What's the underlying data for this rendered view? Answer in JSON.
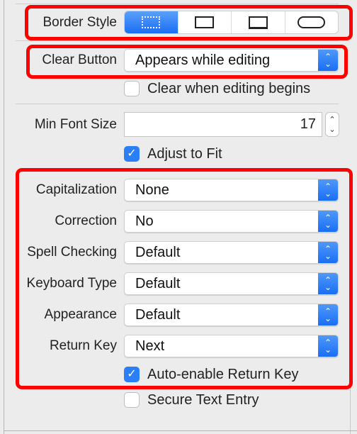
{
  "border_style": {
    "label": "Border Style",
    "options": [
      "none",
      "line",
      "bezel",
      "rounded-rect"
    ],
    "selected": "none"
  },
  "clear_button": {
    "label": "Clear Button",
    "value": "Appears while editing"
  },
  "clear_when_editing": {
    "label": "Clear when editing begins",
    "checked": false
  },
  "min_font_size": {
    "label": "Min Font Size",
    "value": "17"
  },
  "adjust_to_fit": {
    "label": "Adjust to Fit",
    "checked": true
  },
  "rows": [
    {
      "label": "Capitalization",
      "value": "None"
    },
    {
      "label": "Correction",
      "value": "No"
    },
    {
      "label": "Spell Checking",
      "value": "Default"
    },
    {
      "label": "Keyboard Type",
      "value": "Default"
    },
    {
      "label": "Appearance",
      "value": "Default"
    },
    {
      "label": "Return Key",
      "value": "Next"
    }
  ],
  "auto_enable_return_key": {
    "label": "Auto-enable Return Key",
    "checked": true
  },
  "secure_text_entry": {
    "label": "Secure Text Entry",
    "checked": false
  },
  "colors": {
    "accent": "#1a6ef5",
    "highlight": "#ff0000"
  }
}
